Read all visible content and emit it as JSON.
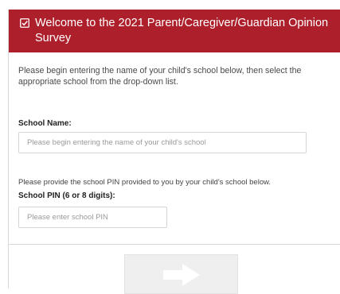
{
  "header": {
    "icon": "checkbox-icon",
    "title": "Welcome to the 2021 Parent/Caregiver/Guardian Opinion Survey",
    "background": "#ad1f2b"
  },
  "intro": {
    "text": "Please begin entering the name of your child's school below, then select the appropriate school from the drop-down list."
  },
  "school_name": {
    "label": "School Name:",
    "placeholder": "Please begin entering the name of your child's school",
    "value": ""
  },
  "pin": {
    "helper": "Please provide the school PIN provided to you by your child's school below.",
    "label": "School PIN (6 or 8 digits):",
    "placeholder": "Please enter school PIN",
    "value": ""
  },
  "next_button": {
    "icon": "arrow-right-icon"
  }
}
